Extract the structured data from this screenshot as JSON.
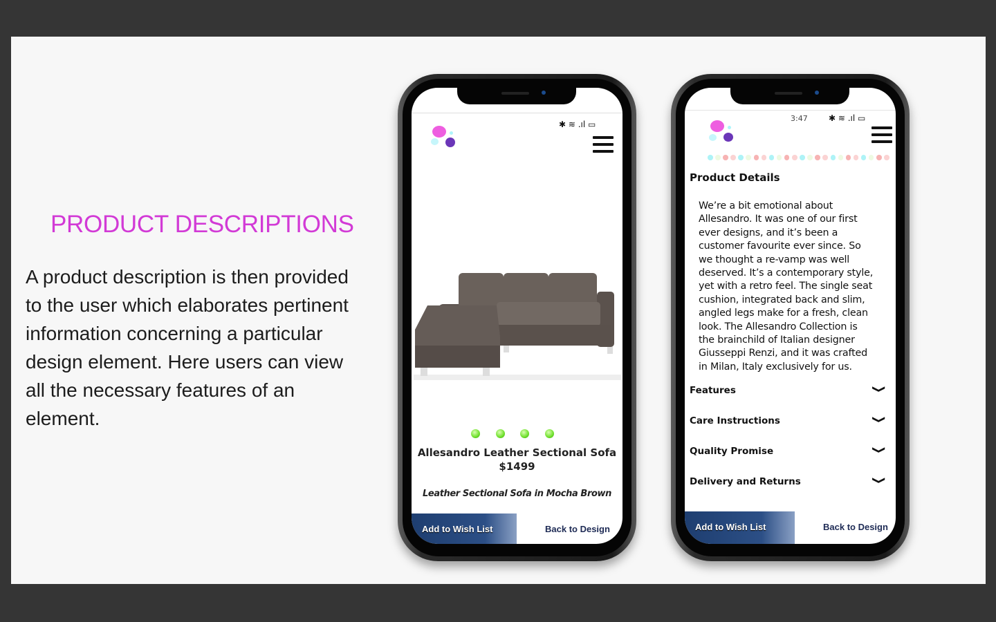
{
  "slide": {
    "heading": "PRODUCT DESCRIPTIONS",
    "body_lines": [
      "A product description is then provided",
      "to the user which  elaborates pertinent",
      "information concerning a particular",
      "design element. Here users can view",
      "all the necessary features of an",
      "element."
    ]
  },
  "phone1": {
    "product_name": "Allesandro Leather Sectional Sofa",
    "price": "$1499",
    "subtitle": "Leather Sectional Sofa in Mocha Brown",
    "carousel_count": 4,
    "wish_label": "Add to Wish List",
    "back_label": "Back to Design"
  },
  "phone2": {
    "time": "3:47",
    "section_title": "Product Details",
    "description_lines": [
      "We’re a bit emotional about",
      "Allesandro. It was one of our first",
      "ever designs, and it’s been a",
      "customer favourite ever since. So",
      "we thought a re-vamp was well",
      "deserved. It’s a contemporary style,",
      "yet with a retro feel. The single seat",
      "cushion, integrated back and slim,",
      "angled legs make for a fresh, clean",
      "look. The Allesandro Collection is",
      "the brainchild of Italian designer",
      "Giusseppi Renzi, and it was crafted",
      "in Milan, Italy exclusively for us."
    ],
    "accordion": [
      "Features",
      "Care Instructions",
      "Quality Promise",
      "Delivery and Returns"
    ],
    "wish_label": "Add to Wish List",
    "back_label": "Back to Design"
  },
  "colors": {
    "heading": "#d23ad6",
    "button": "#2c4f86",
    "carousel": "#6fe02c"
  }
}
